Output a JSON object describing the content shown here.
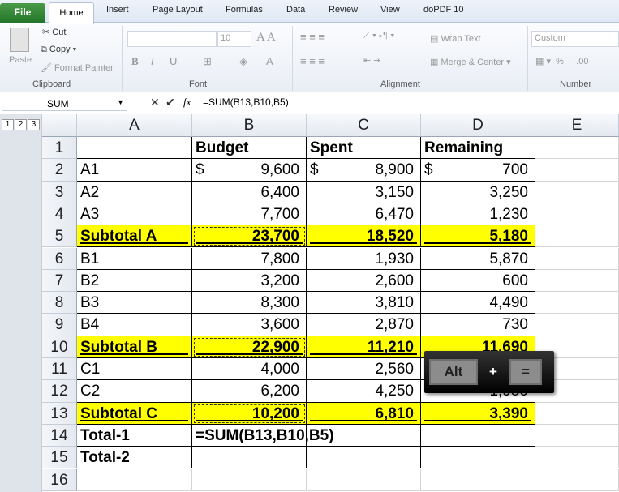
{
  "tabs": [
    "File",
    "Home",
    "Insert",
    "Page Layout",
    "Formulas",
    "Data",
    "Review",
    "View",
    "doPDF 10"
  ],
  "ribbon": {
    "clipboard": {
      "paste": "Paste",
      "cut": "Cut",
      "copy": "Copy",
      "format_painter": "Format Painter",
      "label": "Clipboard"
    },
    "font": {
      "size": "10",
      "label": "Font"
    },
    "alignment": {
      "wrap_text": "Wrap Text",
      "merge_center": "Merge & Center",
      "label": "Alignment"
    },
    "number": {
      "format": "Custom",
      "label": "Number"
    }
  },
  "formula_bar": {
    "name_box": "SUM",
    "formula": "=SUM(B13,B10,B5)"
  },
  "outline_levels": [
    "1",
    "2",
    "3"
  ],
  "columns": [
    "A",
    "B",
    "C",
    "D",
    "E"
  ],
  "rows": [
    {
      "n": "1",
      "a": "",
      "b": "Budget",
      "c": "Spent",
      "d": "Remaining"
    },
    {
      "n": "2",
      "a": "A1",
      "b": "9,600",
      "c": "8,900",
      "d": "700",
      "cur": "$"
    },
    {
      "n": "3",
      "a": "A2",
      "b": "6,400",
      "c": "3,150",
      "d": "3,250"
    },
    {
      "n": "4",
      "a": "A3",
      "b": "7,700",
      "c": "6,470",
      "d": "1,230"
    },
    {
      "n": "5",
      "a": "Subtotal A",
      "b": "23,700",
      "c": "18,520",
      "d": "5,180",
      "sub": true
    },
    {
      "n": "6",
      "a": "B1",
      "b": "7,800",
      "c": "1,930",
      "d": "5,870"
    },
    {
      "n": "7",
      "a": "B2",
      "b": "3,200",
      "c": "2,600",
      "d": "600"
    },
    {
      "n": "8",
      "a": "B3",
      "b": "8,300",
      "c": "3,810",
      "d": "4,490"
    },
    {
      "n": "9",
      "a": "B4",
      "b": "3,600",
      "c": "2,870",
      "d": "730"
    },
    {
      "n": "10",
      "a": "Subtotal B",
      "b": "22,900",
      "c": "11,210",
      "d": "11,690",
      "sub": true
    },
    {
      "n": "11",
      "a": "C1",
      "b": "4,000",
      "c": "2,560",
      "d": ""
    },
    {
      "n": "12",
      "a": "C2",
      "b": "6,200",
      "c": "4,250",
      "d": "1,950"
    },
    {
      "n": "13",
      "a": "Subtotal C",
      "b": "10,200",
      "c": "6,810",
      "d": "3,390",
      "sub": true
    },
    {
      "n": "14",
      "a": "Total-1",
      "b": "=SUM(B13,B10,B5)",
      "c": "",
      "d": "",
      "bold": true,
      "edit": true
    },
    {
      "n": "15",
      "a": "Total-2",
      "b": "",
      "c": "",
      "d": "",
      "bold": true
    },
    {
      "n": "16",
      "a": "",
      "b": "",
      "c": "",
      "d": ""
    }
  ],
  "shortcut": {
    "key1": "Alt",
    "plus": "+",
    "key2": "="
  },
  "colors": {
    "subtotal_fill": "#ffff00",
    "file_tab": "#2a7d2e"
  }
}
